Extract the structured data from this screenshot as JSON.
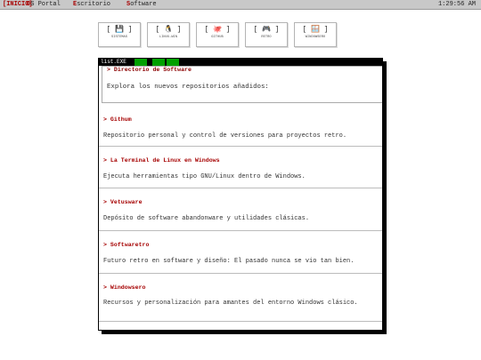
{
  "menubar": {
    "start": "[INICIO]",
    "os_hot": "O",
    "os_rest": "S Portal",
    "esc_hot": "E",
    "esc_rest": "scritorio",
    "soft_hot": "S",
    "soft_rest": "oftware",
    "clock": "1:29:56 AM"
  },
  "desktop_icons": [
    {
      "icon": "floppy-disk-icon",
      "glyph": "💾",
      "label": "SISTEMAS"
    },
    {
      "icon": "penguin-icon",
      "glyph": "🐧",
      "label": "LINUX-WIN"
    },
    {
      "icon": "octopus-icon",
      "glyph": "🐙",
      "label": "GITHUB"
    },
    {
      "icon": "gamepad-icon",
      "glyph": "🎮",
      "label": "RETRO"
    },
    {
      "icon": "windows-logo-icon",
      "glyph": "🪟",
      "label": "WINDOWSERO"
    }
  ],
  "window": {
    "title": "list.EXE",
    "header_title": "> Directorio de Software",
    "header_desc": "Explora los nuevos repositorios añadidos:",
    "entries": [
      {
        "name": "> Githum",
        "desc": "Repositorio personal y control de versiones para proyectos retro."
      },
      {
        "name": "> La Terminal de Linux en Windows",
        "desc": "Ejecuta herramientas tipo GNU/Linux dentro de Windows."
      },
      {
        "name": "> Vetusware",
        "desc": "Depósito de software abandonware y utilidades clásicas."
      },
      {
        "name": "> Softwaretro",
        "desc": "Futuro retro en software y diseño: El pasado nunca se vio tan bien."
      },
      {
        "name": "> Windowsero",
        "desc": "Recursos y personalización para amantes del entorno Windows clásico."
      }
    ]
  },
  "colors": {
    "accent_red": "#a50000",
    "title_green": "#00a000",
    "menubar_gray": "#c8c8c8"
  }
}
